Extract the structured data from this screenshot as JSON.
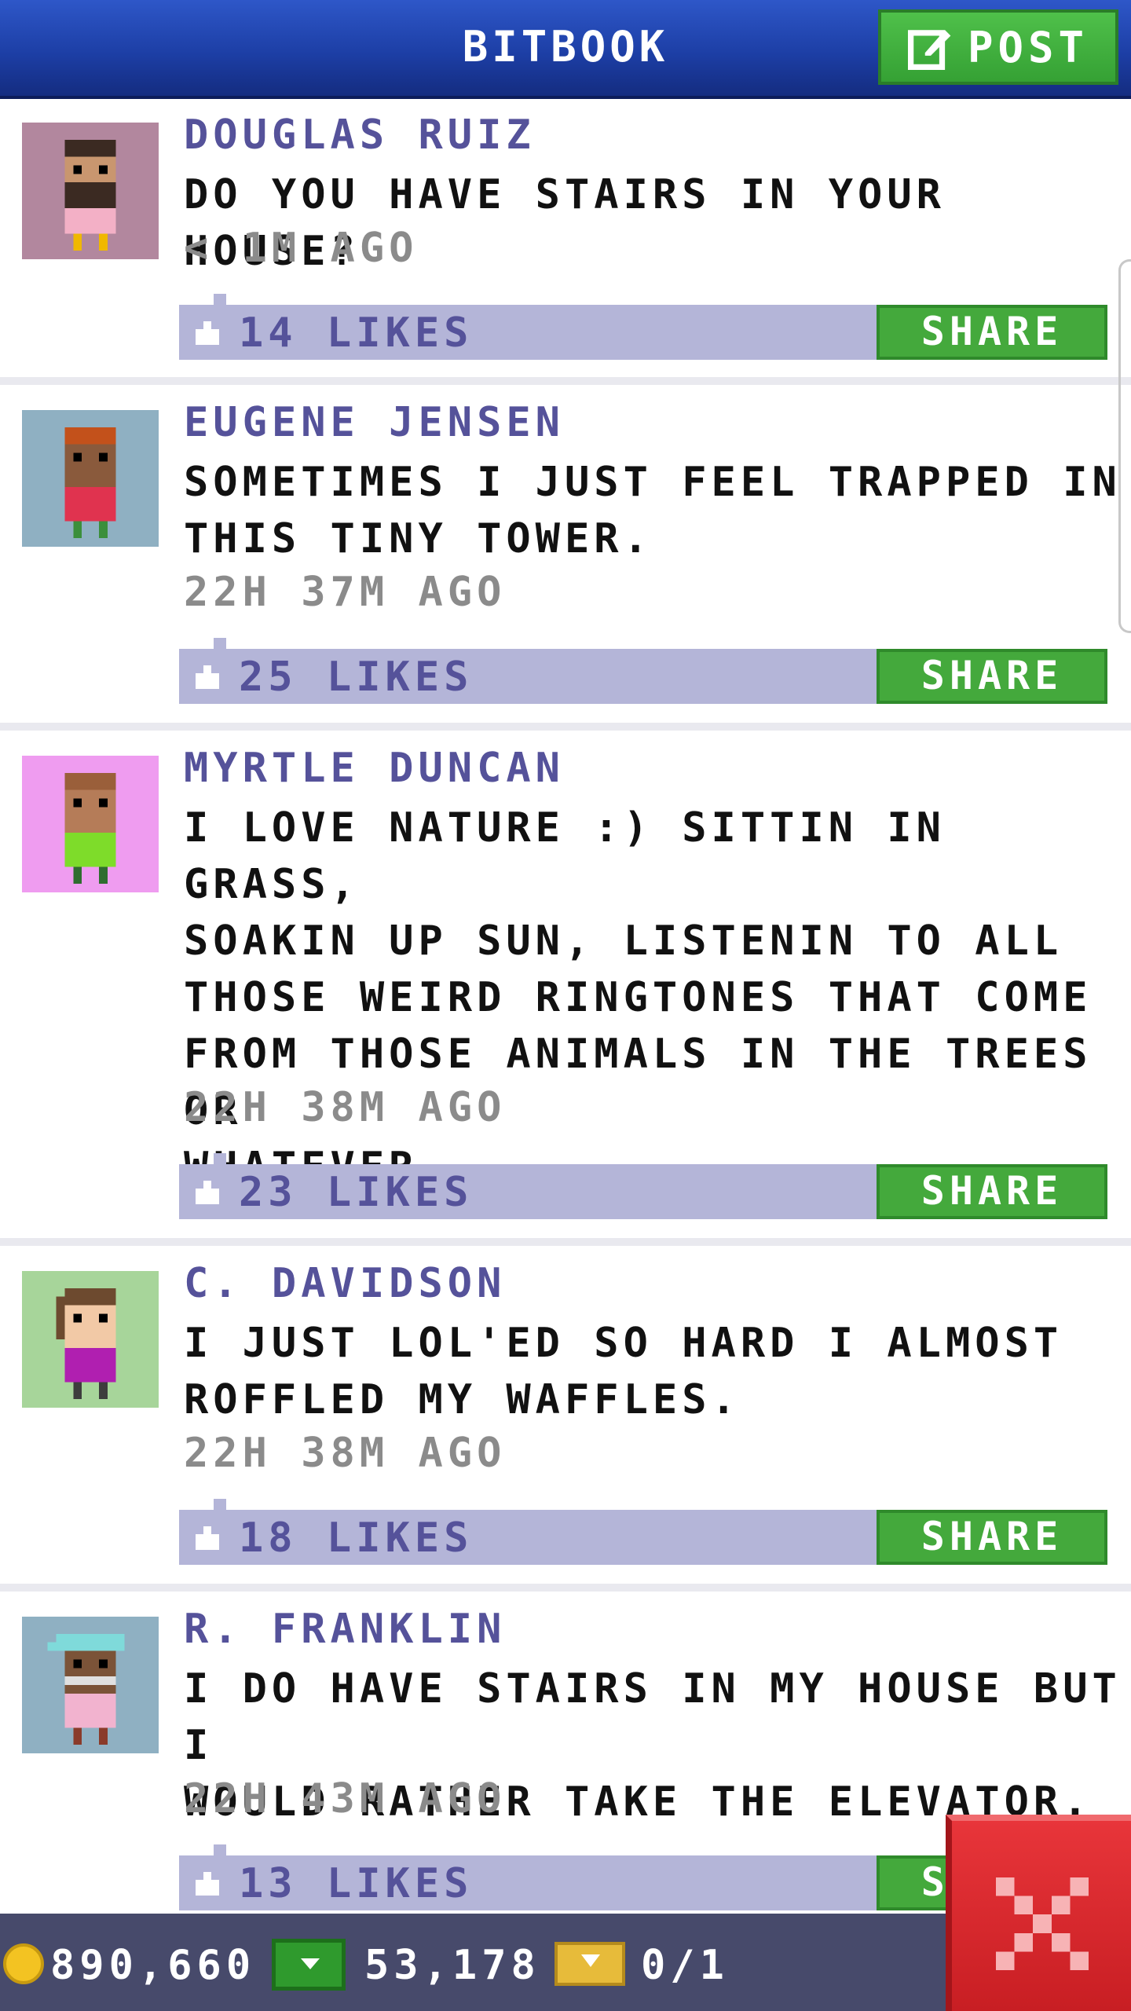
{
  "header": {
    "title": "BITBOOK",
    "post_label": "POST"
  },
  "colors": {
    "header_blue": "#1d3fa6",
    "green": "#44a93c",
    "like_bar": "#b4b5d8",
    "author": "#55529a",
    "close_red": "#d9272d"
  },
  "posts": [
    {
      "author": "DOUGLAS RUIZ",
      "lines": [
        "DO YOU HAVE STAIRS IN YOUR HOUSE?"
      ],
      "time": "< 1M AGO",
      "likes": "14 LIKES",
      "share": "SHARE"
    },
    {
      "author": "EUGENE JENSEN",
      "lines": [
        "SOMETIMES I JUST FEEL TRAPPED IN",
        "THIS TINY TOWER."
      ],
      "time": "22H 37M AGO",
      "likes": "25 LIKES",
      "share": "SHARE"
    },
    {
      "author": "MYRTLE DUNCAN",
      "lines": [
        "I LOVE NATURE :) SITTIN IN GRASS,",
        "SOAKIN UP SUN, LISTENIN TO ALL",
        "THOSE WEIRD RINGTONES THAT COME",
        "FROM THOSE ANIMALS IN THE TREES OR",
        "WHATEVER"
      ],
      "time": "22H 38M AGO",
      "likes": "23 LIKES",
      "share": "SHARE"
    },
    {
      "author": "C. DAVIDSON",
      "lines": [
        "I JUST LOL'ED SO HARD I ALMOST",
        "ROFFLED MY WAFFLES."
      ],
      "time": "22H 38M AGO",
      "likes": "18 LIKES",
      "share": "SHARE"
    },
    {
      "author": "R. FRANKLIN",
      "lines": [
        "I DO HAVE STAIRS IN MY HOUSE BUT I",
        "WOULD RATHER TAKE THE ELEVATOR."
      ],
      "time": "22H 43M AGO",
      "likes": "13 LIKES",
      "share": "SHARE"
    }
  ],
  "bottom": {
    "coins": "890,660",
    "bux": "53,178",
    "tickets": "0/1"
  }
}
